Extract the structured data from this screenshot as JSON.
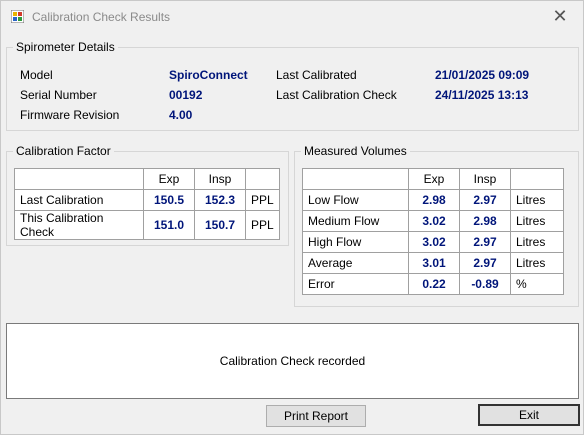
{
  "window": {
    "title": "Calibration Check Results"
  },
  "spirometer": {
    "legend": "Spirometer Details",
    "model_label": "Model",
    "model": "SpiroConnect",
    "serial_label": "Serial Number",
    "serial": "00192",
    "firmware_label": "Firmware Revision",
    "firmware": "4.00",
    "last_cal_label": "Last Calibrated",
    "last_cal": "21/01/2025 09:09",
    "last_check_label": "Last Calibration Check",
    "last_check": "24/11/2025 13:13"
  },
  "factor": {
    "legend": "Calibration Factor",
    "head_exp": "Exp",
    "head_insp": "Insp",
    "rows": [
      {
        "label": "Last Calibration",
        "exp": "150.5",
        "insp": "152.3",
        "unit": "PPL"
      },
      {
        "label": "This Calibration Check",
        "exp": "151.0",
        "insp": "150.7",
        "unit": "PPL"
      }
    ]
  },
  "volumes": {
    "legend": "Measured Volumes",
    "head_exp": "Exp",
    "head_insp": "Insp",
    "rows": [
      {
        "label": "Low Flow",
        "exp": "2.98",
        "insp": "2.97",
        "unit": "Litres"
      },
      {
        "label": "Medium Flow",
        "exp": "3.02",
        "insp": "2.98",
        "unit": "Litres"
      },
      {
        "label": "High Flow",
        "exp": "3.02",
        "insp": "2.97",
        "unit": "Litres"
      },
      {
        "label": "Average",
        "exp": "3.01",
        "insp": "2.97",
        "unit": "Litres"
      },
      {
        "label": "Error",
        "exp": "0.22",
        "insp": "-0.89",
        "unit": "%"
      }
    ]
  },
  "message": "Calibration Check recorded",
  "buttons": {
    "print": "Print Report",
    "exit": "Exit"
  },
  "colors": {
    "value_text": "#00157a",
    "background": "#f0f0f0"
  }
}
